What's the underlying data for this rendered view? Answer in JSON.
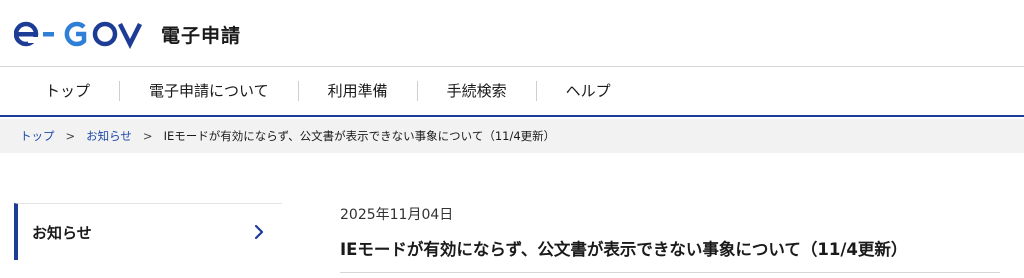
{
  "header": {
    "logo_text": "e-GOV",
    "site_label": "電子申請"
  },
  "gnav": {
    "items": [
      {
        "label": "トップ"
      },
      {
        "label": "電子申請について"
      },
      {
        "label": "利用準備"
      },
      {
        "label": "手続検索"
      },
      {
        "label": "ヘルプ"
      }
    ]
  },
  "breadcrumb": {
    "home": "トップ",
    "separator": ">",
    "section": "お知らせ",
    "current": "IEモードが有効にならず、公文書が表示できない事象について（11/4更新）"
  },
  "sidebar": {
    "label": "お知らせ"
  },
  "article": {
    "date": "2025年11月04日",
    "title": "IEモードが有効にならず、公文書が表示できない事象について（11/4更新）"
  },
  "colors": {
    "brand_navy": "#1d3c96",
    "brand_light_blue": "#2f7fd6",
    "link_blue": "#1d4ca8"
  },
  "icons": {
    "sidebar_arrow": "chevron-right-icon"
  }
}
